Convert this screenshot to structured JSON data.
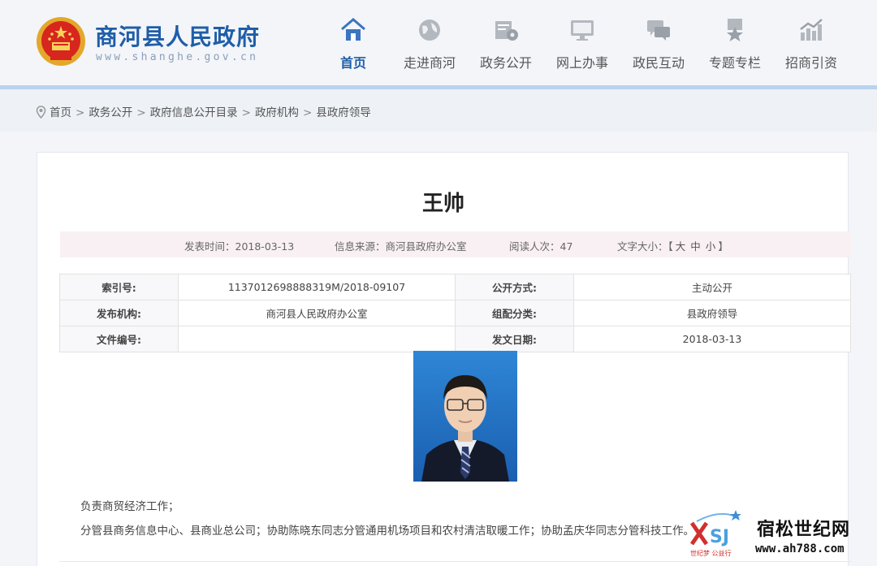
{
  "header": {
    "site_title": "商河县人民政府",
    "site_url": "www.shanghe.gov.cn",
    "nav": [
      {
        "label": "首页",
        "icon": "home-icon",
        "active": true
      },
      {
        "label": "走进商河",
        "icon": "globe-icon"
      },
      {
        "label": "政务公开",
        "icon": "folder-gear-icon"
      },
      {
        "label": "网上办事",
        "icon": "monitor-icon"
      },
      {
        "label": "政民互动",
        "icon": "chat-icon"
      },
      {
        "label": "专题专栏",
        "icon": "badge-star-icon"
      },
      {
        "label": "招商引资",
        "icon": "bar-chart-icon"
      }
    ]
  },
  "breadcrumb": [
    "首页",
    "政务公开",
    "政府信息公开目录",
    "政府机构",
    "县政府领导"
  ],
  "article": {
    "title": "王帅",
    "meta": {
      "publish_time": "发表时间：2018-03-13",
      "source": "信息来源：商河县政府办公室",
      "views": "阅读人次：47",
      "font_size_label": "文字大小：【",
      "font_large": "大",
      "font_medium": "中",
      "font_small": "小",
      "font_end": "】"
    },
    "info_table": [
      [
        "索引号:",
        "1137012698888319M/2018-09107",
        "公开方式:",
        "主动公开"
      ],
      [
        "发布机构:",
        "商河县人民政府办公室",
        "组配分类:",
        "县政府领导"
      ],
      [
        "文件编号:",
        "",
        "发文日期:",
        "2018-03-13"
      ]
    ],
    "paragraphs": [
      "负责商贸经济工作；",
      "分管县商务信息中心、县商业总公司；协助陈晓东同志分管通用机场项目和农村清洁取暖工作；协助孟庆华同志分管科技工作。"
    ]
  },
  "watermark": {
    "name": "宿松世纪网",
    "url": "www.ah788.com",
    "sub": "世纪梦 公益行"
  },
  "colors": {
    "brand": "#1f5ea8",
    "accent_line": "#b9d3ec"
  }
}
